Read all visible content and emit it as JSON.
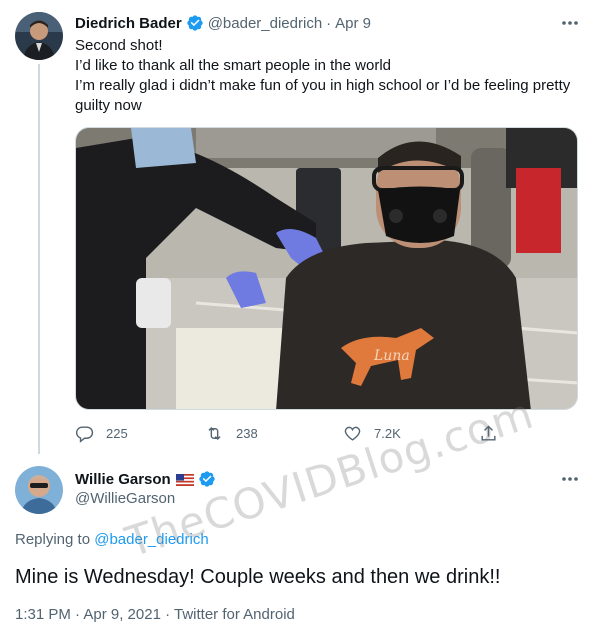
{
  "tweet": {
    "author": {
      "display_name": "Diedrich Bader",
      "handle": "@bader_diedrich",
      "verified": true
    },
    "separator": "·",
    "date": "Apr 9",
    "text_lines": [
      "Second shot!",
      "I’d like to thank all the smart people in the world",
      "I’m really glad i didn’t make fun of you in high school or I’d be feeling pretty guilty now"
    ],
    "photo": {
      "mask_label": "black",
      "shirt_text": "Luna"
    },
    "stats": {
      "replies": "225",
      "retweets": "238",
      "likes": "7.2K"
    },
    "icons": {
      "reply": "reply-icon",
      "retweet": "retweet-icon",
      "like": "heart-icon",
      "share": "share-icon",
      "more": "more-icon",
      "verified": "verified-badge-icon"
    }
  },
  "reply": {
    "author": {
      "display_name": "Willie Garson",
      "handle": "@WillieGarson",
      "verified": true,
      "flag": "us-flag-icon"
    },
    "replying_to_prefix": "Replying to",
    "replying_to_handle": "@bader_diedrich",
    "text": "Mine is Wednesday! Couple weeks and then we drink!!",
    "meta": "1:31 PM · Apr 9, 2021 · Twitter for Android"
  },
  "watermark": "TheCOVIDBlog.com",
  "colors": {
    "text": "#0f1419",
    "secondary": "#536471",
    "link": "#1d9bf0",
    "verified": "#1d9bf0",
    "line": "#cfd9de"
  }
}
